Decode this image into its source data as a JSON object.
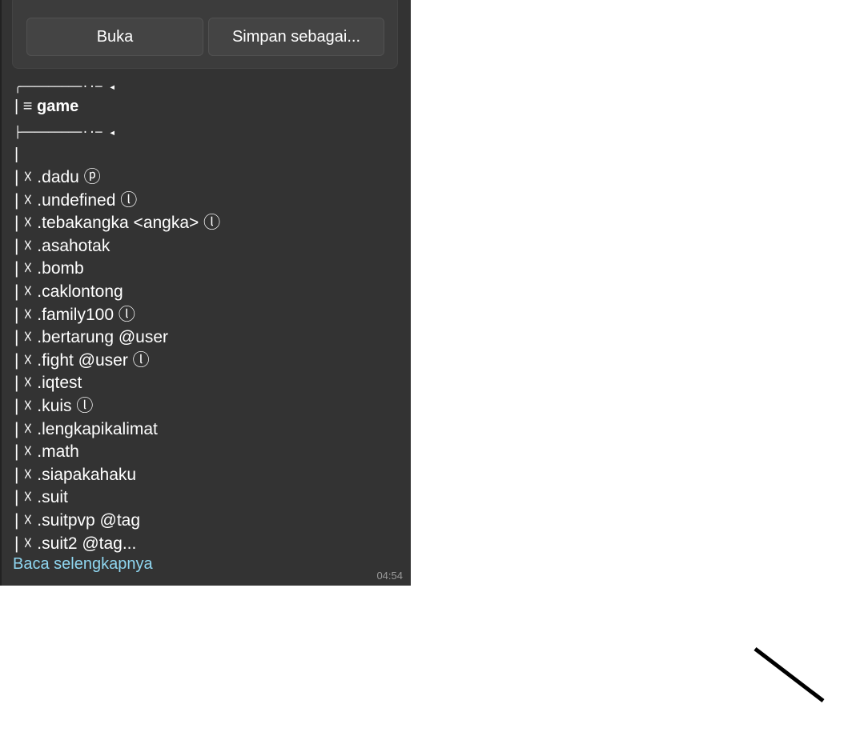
{
  "file_actions": {
    "open_label": "Buka",
    "save_as_label": "Simpan sebagai..."
  },
  "menu": {
    "top_border": "╭─────────··─ ◂",
    "title_prefix": "| ≡ ",
    "title": "game",
    "bottom_border": "├─────────··─ ◂",
    "pipe": "|",
    "items": [
      "| ☓ .dadu ⓟ",
      "| ☓ .undefined ⓛ",
      "| ☓ .tebakangka <angka> ⓛ",
      "| ☓ .asahotak",
      "| ☓ .bomb",
      "| ☓ .caklontong",
      "| ☓ .family100 ⓛ",
      "| ☓ .bertarung @user",
      "| ☓ .fight @user ⓛ",
      "| ☓ .iqtest",
      "| ☓ .kuis ⓛ",
      "| ☓ .lengkapikalimat",
      "| ☓ .math",
      "| ☓ .siapakahaku",
      "| ☓ .suit",
      "| ☓ .suitpvp @tag",
      "| ☓ .suit2 @tag..."
    ]
  },
  "read_more_label": "Baca selengkapnya",
  "timestamp": "04:54",
  "colors": {
    "bubble_bg": "#333333",
    "link": "#8fd6f0",
    "timestamp": "#9a9a9a"
  }
}
